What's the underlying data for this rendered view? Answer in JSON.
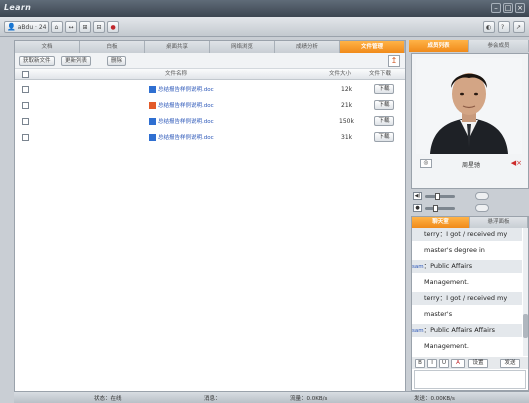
{
  "app": {
    "title": "Learn"
  },
  "window_buttons": [
    "–",
    "□",
    "×"
  ],
  "toolbar": {
    "user_label": "aBdu · 24",
    "group1": [
      "⌂",
      "↔",
      "⊞",
      "⊟"
    ],
    "record_label": "●",
    "right_icons": [
      "◐",
      "?",
      "↗"
    ]
  },
  "tabs": [
    {
      "label": "文档",
      "active": false
    },
    {
      "label": "白板",
      "active": false
    },
    {
      "label": "桌面共享",
      "active": false
    },
    {
      "label": "网络浏览",
      "active": false
    },
    {
      "label": "成绩分析",
      "active": false
    },
    {
      "label": "文件管理",
      "active": true
    }
  ],
  "actions": {
    "btn1": "获取新文件",
    "btn2": "更新列表",
    "btn3": "删除",
    "upload_icon": "↥"
  },
  "table": {
    "headers": {
      "name": "文件名称",
      "size": "文件大小",
      "download": "文件下载"
    },
    "rows": [
      {
        "name": "总结报告样例说明.doc",
        "size": "12k",
        "action": "下载",
        "alt": false
      },
      {
        "name": "总结报告样例说明.doc",
        "size": "21k",
        "action": "下载",
        "alt": true
      },
      {
        "name": "总结报告样例说明.doc",
        "size": "150k",
        "action": "下载",
        "alt": false
      },
      {
        "name": "总结报告样例说明.doc",
        "size": "31k",
        "action": "下载",
        "alt": false
      }
    ]
  },
  "statusbar": {
    "left": "状态：在线",
    "mid": "消息：",
    "traffic": "流量：0.0KB/s",
    "right": "发送：0.00KB/s"
  },
  "right": {
    "tabs": [
      {
        "label": "成员列表",
        "active": true
      },
      {
        "label": "参会成员",
        "active": false
      }
    ],
    "video": {
      "speaker": "周星驰",
      "cam_label": "◎",
      "mute_label": "◀×"
    },
    "controls": [
      {
        "icon": "◀)",
        "value": 0.4
      },
      {
        "icon": "●",
        "value": 0.3
      }
    ]
  },
  "chat": {
    "tabs": [
      {
        "label": "聊天室",
        "active": true
      },
      {
        "label": "悬浮面板",
        "active": false
      }
    ],
    "lines": [
      {
        "name": "",
        "text": "terry：I got / received my",
        "shade": true
      },
      {
        "name": "",
        "text": "master's degree in",
        "shade": false
      },
      {
        "name": "sam",
        "text": "Public Affairs",
        "shade": true
      },
      {
        "name": "",
        "text": "Management.",
        "shade": false
      },
      {
        "name": "",
        "text": "terry：I got / received my",
        "shade": true
      },
      {
        "name": "",
        "text": "master's",
        "shade": false
      },
      {
        "name": "sam",
        "text": "Public Affairs Affairs",
        "shade": true
      },
      {
        "name": "",
        "text": "Management.",
        "shade": false
      }
    ],
    "format_buttons": [
      "B",
      "I",
      "U",
      "A",
      "设置",
      "发送"
    ]
  }
}
